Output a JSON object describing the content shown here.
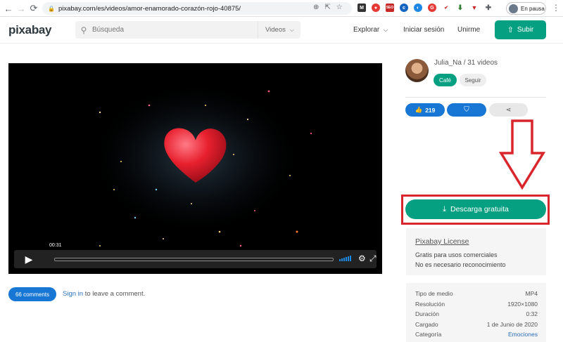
{
  "browser": {
    "url": "pixabay.com/es/videos/amor-enamorado-corazón-rojo-40875/",
    "paused_label": "En pausa"
  },
  "header": {
    "logo": "pixabay",
    "search_placeholder": "Búsqueda",
    "search_type": "Videos",
    "explore": "Explorar",
    "login": "Iniciar sesión",
    "join": "Unirme",
    "upload": "Subir"
  },
  "player": {
    "time": "00:31"
  },
  "comments": {
    "count_label": "66 comments",
    "signin_link": "Sign in",
    "signin_rest": " to leave a comment."
  },
  "author": {
    "name": "Julia_Na / 31 videos",
    "coffee": "Café",
    "follow": "Seguir"
  },
  "actions": {
    "likes": "219"
  },
  "download": {
    "label": "Descarga gratuita"
  },
  "license": {
    "title": "Pixabay License",
    "line1": "Gratis para usos comerciales",
    "line2": "No es necesario reconocimiento"
  },
  "meta": {
    "rows": [
      {
        "label": "Tipo de medio",
        "value": "MP4"
      },
      {
        "label": "Resolución",
        "value": "1920×1080"
      },
      {
        "label": "Duración",
        "value": "0:32"
      },
      {
        "label": "Cargado",
        "value": "1 de Junio de 2020"
      },
      {
        "label": "Categoría",
        "value": "Emociones"
      }
    ]
  },
  "colors": {
    "brand_green": "#05a081",
    "blue": "#1877d4",
    "highlight_red": "#d9262c"
  }
}
